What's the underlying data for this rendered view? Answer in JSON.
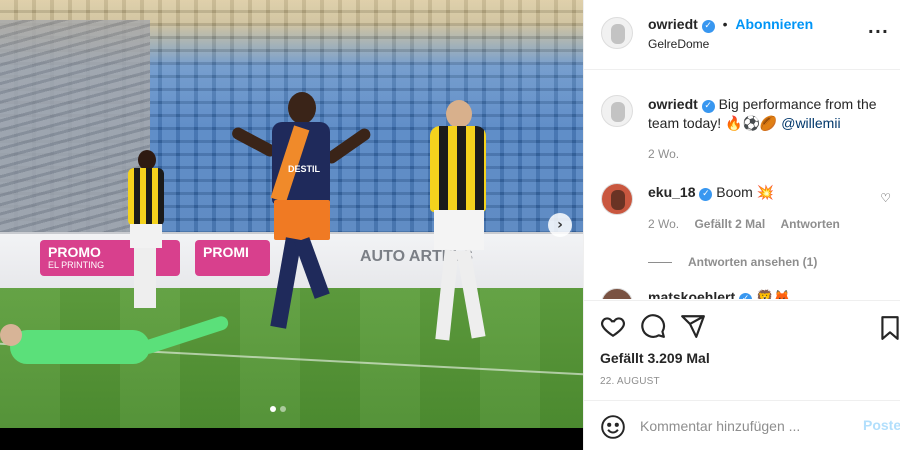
{
  "post": {
    "author": "owriedt",
    "follow_label": "Abonnieren",
    "header_separator": "•",
    "location": "GelreDome",
    "more_glyph": "···"
  },
  "photo": {
    "ad_text_1": "PROMO",
    "ad_text_1_sub": "EL PRINTING",
    "ad_text_2": "PROMI",
    "ad_text_3": "AUTO   ARTELS",
    "jersey_sponsor": "DESTIL",
    "slide_count": 2,
    "active_slide": 1
  },
  "caption": {
    "username": "owriedt",
    "text": "Big performance from the team today! 🔥⚽🏉",
    "mention": "@willemii",
    "time": "2 Wo."
  },
  "comments": [
    {
      "username": "eku_18",
      "text": "Boom 💥",
      "time": "2 Wo.",
      "likes": "Gefällt 2 Mal",
      "reply": "Antworten",
      "view_replies": "Antworten ansehen (1)"
    },
    {
      "username": "matskoehlert",
      "text": "🦁🦊"
    }
  ],
  "actions": {
    "likes": "Gefällt 3.209 Mal",
    "date": "22. AUGUST"
  },
  "composer": {
    "placeholder": "Kommentar hinzufügen ...",
    "post_label": "Posten"
  },
  "colors": {
    "accent": "#0095f6",
    "verified": "#3897f0",
    "muted": "#8e8e8e",
    "post_disabled": "#b2dffc"
  }
}
